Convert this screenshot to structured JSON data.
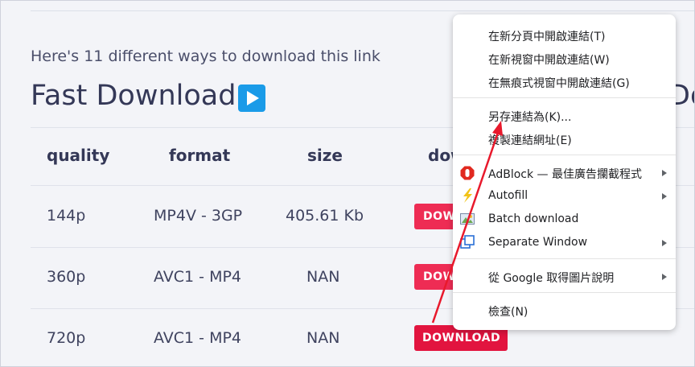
{
  "page": {
    "intro": "Here's 11 different ways to download this link",
    "title": "Fast Download",
    "right_title_fragment": "Do"
  },
  "table": {
    "headers": [
      "quality",
      "format",
      "size",
      "dow"
    ],
    "rows": [
      {
        "quality": "144p",
        "format": "MP4V - 3GP",
        "size": "405.61 Kb",
        "button": "DOWNLOAD"
      },
      {
        "quality": "360p",
        "format": "AVC1 - MP4",
        "size": "NAN",
        "button": "DOWNLOAD"
      },
      {
        "quality": "720p",
        "format": "AVC1 - MP4",
        "size": "NAN",
        "button": "DOWNLOAD"
      }
    ]
  },
  "context_menu": {
    "open_new_tab": "在新分頁中開啟連結(T)",
    "open_new_window": "在新視窗中開啟連結(W)",
    "open_incognito": "在無痕式視窗中開啟連結(G)",
    "save_link_as": "另存連結為(K)...",
    "copy_link": "複製連結網址(E)",
    "adblock": "AdBlock — 最佳廣告攔截程式",
    "autofill": "Autofill",
    "batch_download": "Batch download",
    "separate_window": "Separate Window",
    "google_image": "從 Google 取得圖片說明",
    "inspect": "檢查(N)"
  },
  "icons": {
    "play": "play-icon",
    "adblock": "adblock-stop-icon",
    "autofill": "lightning-icon",
    "batch": "image-download-icon",
    "separate_window": "window-icon",
    "submenu": "chevron-right-icon"
  },
  "colors": {
    "accent_button": "#ee2c54",
    "play_blue": "#1a9be8",
    "annotation_arrow": "#e8192c"
  }
}
